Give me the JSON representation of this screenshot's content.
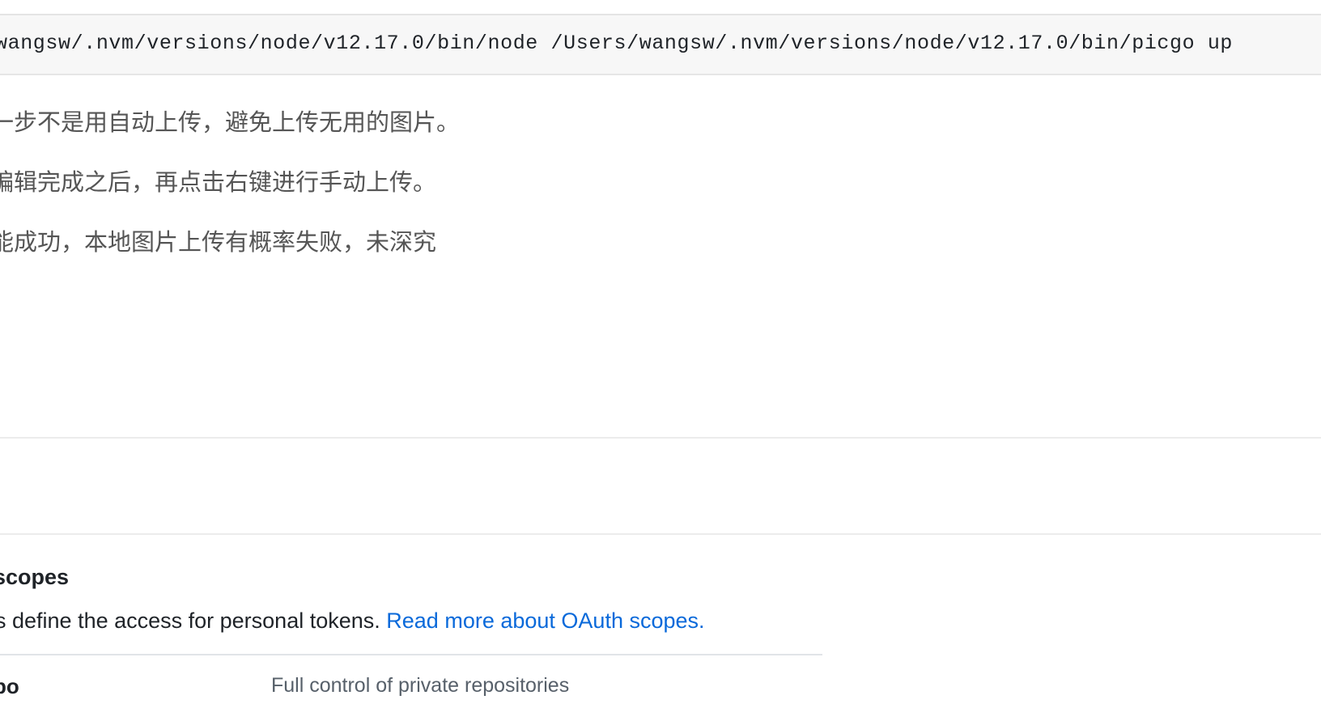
{
  "code_block": {
    "command": "wangsw/.nvm/versions/node/v12.17.0/bin/node /Users/wangsw/.nvm/versions/node/v12.17.0/bin/picgo up"
  },
  "notes": [
    "一步不是用自动上传，避免上传无用的图片。",
    "编辑完成之后，再点击右键进行手动上传。",
    "能成功，本地图片上传有概率失败，未深究"
  ],
  "scopes_section": {
    "heading": "scopes",
    "description": "s define the access for personal tokens. ",
    "link_label": "Read more about OAuth scopes.",
    "link_color": "#0969da",
    "rows": [
      {
        "name": "po",
        "description": "Full control of private repositories"
      }
    ]
  }
}
